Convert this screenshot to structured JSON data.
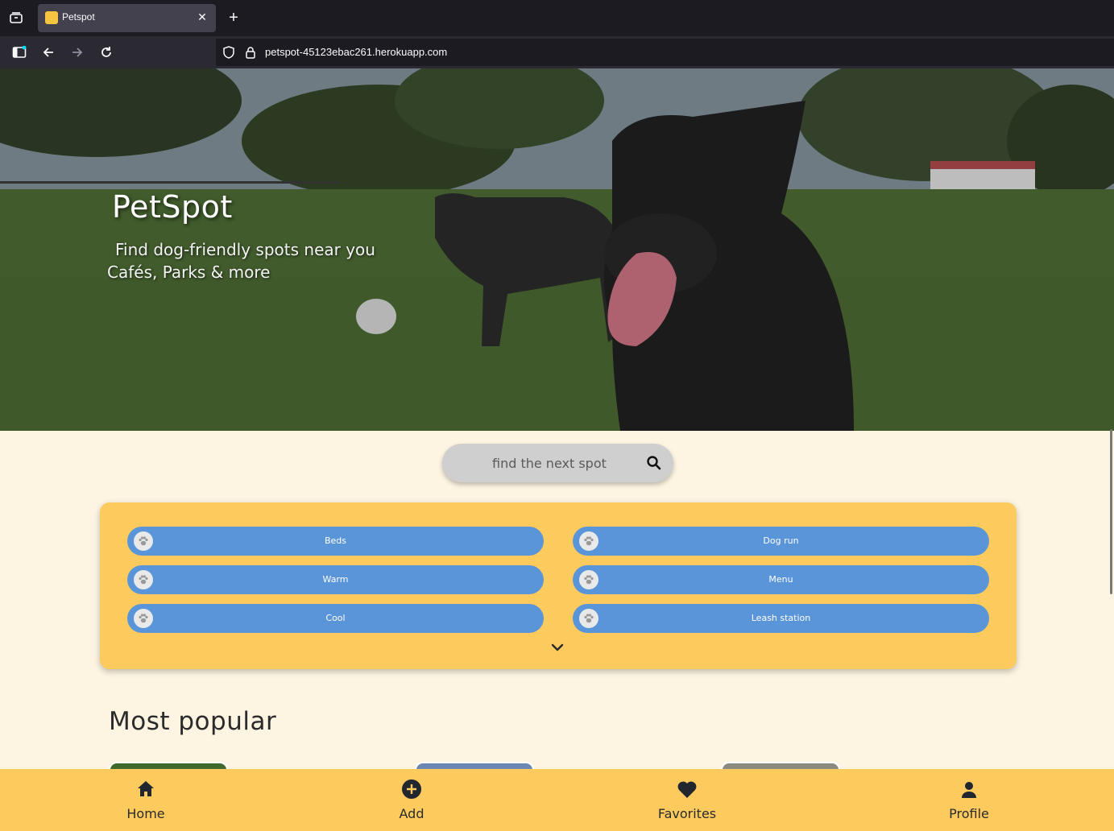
{
  "browser": {
    "tab_title": "Petspot",
    "url": "petspot-45123ebac261.herokuapp.com"
  },
  "hero": {
    "title": "PetSpot",
    "subtitle_line1": "Find dog-friendly spots near you",
    "subtitle_line2": "Cafés, Parks & more"
  },
  "search": {
    "placeholder": "find the next spot"
  },
  "filters": {
    "left": [
      "Beds",
      "Warm",
      "Cool"
    ],
    "right": [
      "Dog run",
      "Menu",
      "Leash station"
    ]
  },
  "popular": {
    "title": "Most popular"
  },
  "bottom_nav": {
    "home": "Home",
    "add": "Add",
    "favorites": "Favorites",
    "profile": "Profile"
  },
  "colors": {
    "accent_yellow": "#fdca5e",
    "chip_blue": "#5b95d9",
    "page_bg": "#fdf5e2"
  }
}
